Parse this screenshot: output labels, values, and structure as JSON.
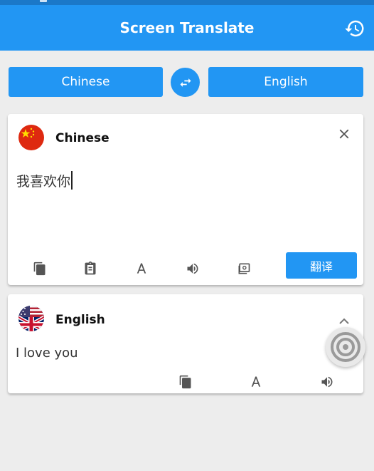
{
  "app": {
    "title": "Screen Translate"
  },
  "languages": {
    "source": "Chinese",
    "target": "English"
  },
  "input_card": {
    "language": "Chinese",
    "text": "我喜欢你",
    "translate_label": "翻译"
  },
  "output_card": {
    "language": "English",
    "text": "I love you"
  },
  "colors": {
    "accent": "#2296f3",
    "statusbar": "#1b78c8",
    "background": "#ededed"
  },
  "icons": {
    "history": "history-icon",
    "swap": "swap-icon",
    "close": "close-icon",
    "copy": "copy-icon",
    "paste": "paste-icon",
    "font": "font-icon",
    "speaker": "speaker-icon",
    "image": "image-icon",
    "collapse": "chevron-up-icon",
    "floating": "target-icon"
  }
}
